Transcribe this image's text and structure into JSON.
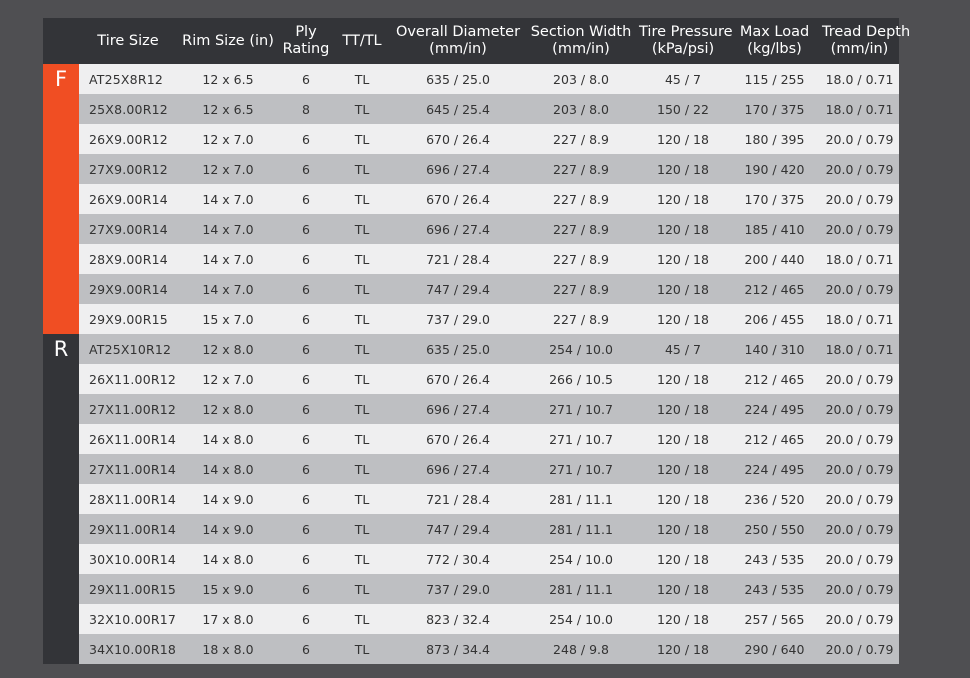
{
  "colors": {
    "background": "#4f4f52",
    "table_dark": "#333438",
    "front_accent": "#f04e23",
    "row_light": "#efeff0",
    "row_dark": "#bebfc2"
  },
  "headers": [
    [
      "Tire Size"
    ],
    [
      "Rim Size (in)"
    ],
    [
      "Ply",
      "Rating"
    ],
    [
      "TT/TL"
    ],
    [
      "Overall Diameter",
      "(mm/in)"
    ],
    [
      "Section Width",
      "(mm/in)"
    ],
    [
      "Tire Pressure",
      "(kPa/psi)"
    ],
    [
      "Max Load",
      "(kg/lbs)"
    ],
    [
      "Tread Depth",
      "(mm/in)"
    ]
  ],
  "sections": {
    "front": "F",
    "rear": "R"
  },
  "rows": [
    [
      "AT25X8R12",
      "12 x 6.5",
      "6",
      "TL",
      "635 / 25.0",
      "203 / 8.0",
      "45 / 7",
      "115 / 255",
      "18.0 / 0.71"
    ],
    [
      "25X8.00R12",
      "12 x 6.5",
      "8",
      "TL",
      "645 / 25.4",
      "203 / 8.0",
      "150 / 22",
      "170 / 375",
      "18.0 / 0.71"
    ],
    [
      "26X9.00R12",
      "12 x 7.0",
      "6",
      "TL",
      "670 / 26.4",
      "227 / 8.9",
      "120 / 18",
      "180 / 395",
      "20.0 / 0.79"
    ],
    [
      "27X9.00R12",
      "12 x 7.0",
      "6",
      "TL",
      "696 / 27.4",
      "227 / 8.9",
      "120 / 18",
      "190 / 420",
      "20.0 / 0.79"
    ],
    [
      "26X9.00R14",
      "14 x 7.0",
      "6",
      "TL",
      "670 / 26.4",
      "227 / 8.9",
      "120 / 18",
      "170 / 375",
      "20.0 / 0.79"
    ],
    [
      "27X9.00R14",
      "14 x 7.0",
      "6",
      "TL",
      "696 / 27.4",
      "227 / 8.9",
      "120 / 18",
      "185 / 410",
      "20.0 / 0.79"
    ],
    [
      "28X9.00R14",
      "14 x 7.0",
      "6",
      "TL",
      "721 / 28.4",
      "227 / 8.9",
      "120 / 18",
      "200 / 440",
      "18.0 / 0.71"
    ],
    [
      "29X9.00R14",
      "14 x 7.0",
      "6",
      "TL",
      "747 / 29.4",
      "227 / 8.9",
      "120 / 18",
      "212 / 465",
      "20.0 / 0.79"
    ],
    [
      "29X9.00R15",
      "15 x 7.0",
      "6",
      "TL",
      "737 / 29.0",
      "227 / 8.9",
      "120 / 18",
      "206 / 455",
      "18.0 / 0.71"
    ],
    [
      "AT25X10R12",
      "12 x 8.0",
      "6",
      "TL",
      "635 / 25.0",
      "254 / 10.0",
      "45 / 7",
      "140 / 310",
      "18.0 / 0.71"
    ],
    [
      "26X11.00R12",
      "12 x 7.0",
      "6",
      "TL",
      "670 / 26.4",
      "266 / 10.5",
      "120 / 18",
      "212 / 465",
      "20.0 / 0.79"
    ],
    [
      "27X11.00R12",
      "12 x 8.0",
      "6",
      "TL",
      "696 / 27.4",
      "271 / 10.7",
      "120 / 18",
      "224 / 495",
      "20.0 / 0.79"
    ],
    [
      "26X11.00R14",
      "14 x 8.0",
      "6",
      "TL",
      "670 / 26.4",
      "271 / 10.7",
      "120 / 18",
      "212 / 465",
      "20.0 / 0.79"
    ],
    [
      "27X11.00R14",
      "14 x 8.0",
      "6",
      "TL",
      "696 / 27.4",
      "271 / 10.7",
      "120 / 18",
      "224 / 495",
      "20.0 / 0.79"
    ],
    [
      "28X11.00R14",
      "14 x 9.0",
      "6",
      "TL",
      "721 / 28.4",
      "281 / 11.1",
      "120 / 18",
      "236 / 520",
      "20.0 / 0.79"
    ],
    [
      "29X11.00R14",
      "14 x 9.0",
      "6",
      "TL",
      "747 / 29.4",
      "281 / 11.1",
      "120 / 18",
      "250 / 550",
      "20.0 / 0.79"
    ],
    [
      "30X10.00R14",
      "14 x 8.0",
      "6",
      "TL",
      "772 / 30.4",
      "254 / 10.0",
      "120 / 18",
      "243 / 535",
      "20.0 / 0.79"
    ],
    [
      "29X11.00R15",
      "15 x 9.0",
      "6",
      "TL",
      "737 / 29.0",
      "281 / 11.1",
      "120 / 18",
      "243 / 535",
      "20.0 / 0.79"
    ],
    [
      "32X10.00R17",
      "17 x 8.0",
      "6",
      "TL",
      "823 / 32.4",
      "254 / 10.0",
      "120 / 18",
      "257 / 565",
      "20.0 / 0.79"
    ],
    [
      "34X10.00R18",
      "18 x 8.0",
      "6",
      "TL",
      "873 / 34.4",
      "248 / 9.8",
      "120 / 18",
      "290 / 640",
      "20.0 / 0.79"
    ]
  ]
}
